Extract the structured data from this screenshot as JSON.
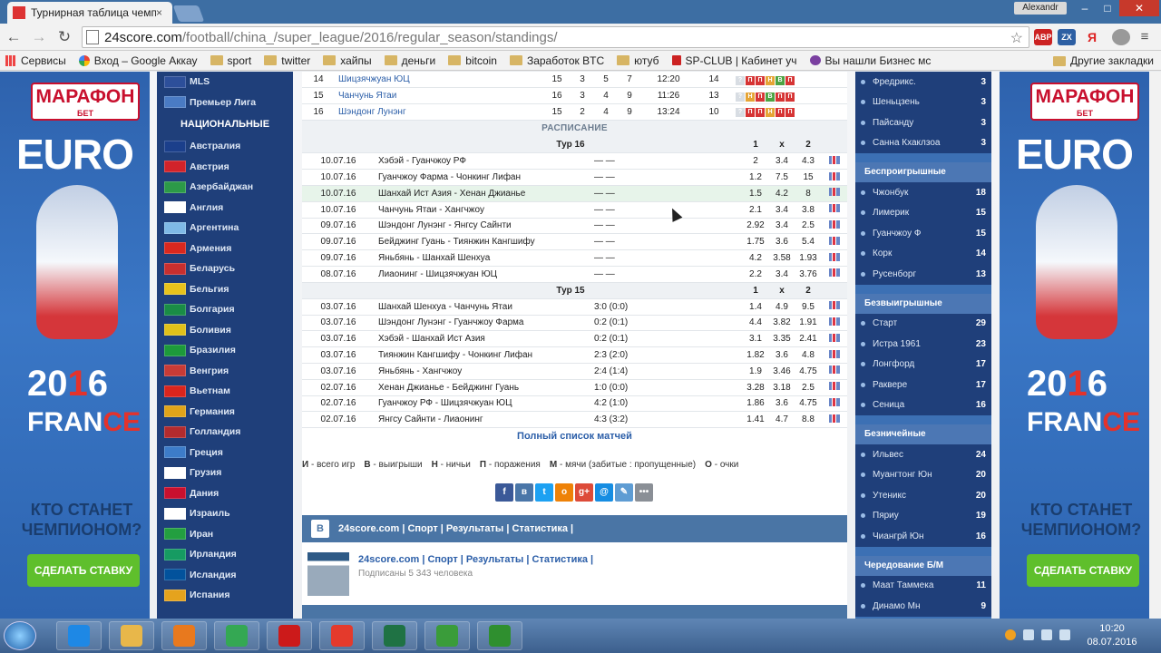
{
  "browser": {
    "tab_title": "Турнирная таблица чемп",
    "tab_close": "×",
    "window_user": "Alexandr",
    "window_controls": {
      "minimize": "–",
      "maximize": "□",
      "close": "✕"
    },
    "url_host": "24score.com",
    "url_path": "/football/china_/super_league/2016/regular_season/standings/",
    "nav": {
      "back": "←",
      "forward": "→",
      "reload": "↻"
    },
    "star": "☆",
    "extensions": [
      "ABP",
      "ZX",
      "Я",
      "≡"
    ]
  },
  "bookmarks": [
    {
      "label": "Сервисы",
      "icon": "apps-icon"
    },
    {
      "label": "Вход – Google Аккау",
      "icon": "google-icon"
    },
    {
      "label": "sport",
      "icon": "folder-icon"
    },
    {
      "label": "twitter",
      "icon": "folder-icon"
    },
    {
      "label": "хайпы",
      "icon": "folder-icon"
    },
    {
      "label": "деньги",
      "icon": "folder-icon"
    },
    {
      "label": "bitcoin",
      "icon": "folder-icon"
    },
    {
      "label": "Заработок BTC",
      "icon": "folder-icon"
    },
    {
      "label": "ютуб",
      "icon": "folder-icon"
    },
    {
      "label": "SP-CLUB | Кабинет уч",
      "icon": "k-icon"
    },
    {
      "label": "Вы нашли Бизнес мс",
      "icon": "site-icon"
    }
  ],
  "bookmarks_other": "Другие закладки",
  "ad": {
    "brand": "МАРАФОН",
    "brand_sub": "БЕТ",
    "euro": "EURO",
    "year_a": "20",
    "year_b": "1",
    "year_c": "6",
    "france_a": "FRAN",
    "france_b": "CE",
    "question": "КТО СТАНЕТ ЧЕМПИОНОМ?",
    "bet_button": "СДЕЛАТЬ СТАВКУ"
  },
  "left_nav": {
    "top_items": [
      "MLS",
      "Премьер Лига"
    ],
    "header": "НАЦИОНАЛЬНЫЕ",
    "countries": [
      {
        "name": "Австралия",
        "color": "#1b3f8b"
      },
      {
        "name": "Австрия",
        "color": "#d2232a"
      },
      {
        "name": "Азербайджан",
        "color": "#2c9a48"
      },
      {
        "name": "Англия",
        "color": "#ffffff"
      },
      {
        "name": "Аргентина",
        "color": "#7fb9e6"
      },
      {
        "name": "Армения",
        "color": "#d9281f"
      },
      {
        "name": "Беларусь",
        "color": "#c82f2f"
      },
      {
        "name": "Бельгия",
        "color": "#e8c31c"
      },
      {
        "name": "Болгария",
        "color": "#1a8c46"
      },
      {
        "name": "Боливия",
        "color": "#e1c11a"
      },
      {
        "name": "Бразилия",
        "color": "#1d9a3b"
      },
      {
        "name": "Венгрия",
        "color": "#c83b36"
      },
      {
        "name": "Вьетнам",
        "color": "#da251d"
      },
      {
        "name": "Германия",
        "color": "#e0a41a"
      },
      {
        "name": "Голландия",
        "color": "#b32b2e"
      },
      {
        "name": "Греция",
        "color": "#3d7cc9"
      },
      {
        "name": "Грузия",
        "color": "#ffffff"
      },
      {
        "name": "Дания",
        "color": "#c8102e"
      },
      {
        "name": "Израиль",
        "color": "#ffffff"
      },
      {
        "name": "Иран",
        "color": "#239f40"
      },
      {
        "name": "Ирландия",
        "color": "#169b62"
      },
      {
        "name": "Исландия",
        "color": "#02529c"
      },
      {
        "name": "Испания",
        "color": "#e5a31d"
      }
    ]
  },
  "standings": [
    {
      "pos": "14",
      "team": "Шицзячжуан ЮЦ",
      "g": "15",
      "w": "3",
      "d": "5",
      "l": "7",
      "goals": "12:20",
      "pts": "14",
      "form": [
        "N",
        "L",
        "L",
        "D",
        "W",
        "L"
      ]
    },
    {
      "pos": "15",
      "team": "Чанчунь Ятаи",
      "g": "16",
      "w": "3",
      "d": "4",
      "l": "9",
      "goals": "11:26",
      "pts": "13",
      "form": [
        "N",
        "D",
        "L",
        "W",
        "L",
        "L"
      ]
    },
    {
      "pos": "16",
      "team": "Шэндонг Лунэнг",
      "g": "15",
      "w": "2",
      "d": "4",
      "l": "9",
      "goals": "13:24",
      "pts": "10",
      "form": [
        "N",
        "L",
        "L",
        "D",
        "L",
        "L"
      ]
    }
  ],
  "schedule": {
    "title": "РАСПИСАНИЕ",
    "odds_headers": [
      "1",
      "x",
      "2"
    ],
    "rounds": [
      {
        "name": "Тур 16",
        "matches": [
          {
            "date": "10.07.16",
            "match": "Хэбэй - Гуанчжоу РФ",
            "score": "— —",
            "o1": "2",
            "ox": "3.4",
            "o2": "4.3"
          },
          {
            "date": "10.07.16",
            "match": "Гуанчжоу Фарма - Чонкинг Лифан",
            "score": "— —",
            "o1": "1.2",
            "ox": "7.5",
            "o2": "15"
          },
          {
            "date": "10.07.16",
            "match": "Шанхай Ист Азия - Хенан Джианье",
            "score": "— —",
            "o1": "1.5",
            "ox": "4.2",
            "o2": "8",
            "highlight": true
          },
          {
            "date": "10.07.16",
            "match": "Чанчунь Ятаи - Хангчжоу",
            "score": "— —",
            "o1": "2.1",
            "ox": "3.4",
            "o2": "3.8"
          },
          {
            "date": "09.07.16",
            "match": "Шэндонг Лунэнг - Янгсу Сайнти",
            "score": "— —",
            "o1": "2.92",
            "ox": "3.4",
            "o2": "2.5"
          },
          {
            "date": "09.07.16",
            "match": "Бейджинг Гуань - Тиянжин Кангшифу",
            "score": "— —",
            "o1": "1.75",
            "ox": "3.6",
            "o2": "5.4"
          },
          {
            "date": "09.07.16",
            "match": "Яньбянь - Шанхай Шенхуа",
            "score": "— —",
            "o1": "4.2",
            "ox": "3.58",
            "o2": "1.93"
          },
          {
            "date": "08.07.16",
            "match": "Лиаонинг - Шицзячжуан ЮЦ",
            "score": "— —",
            "o1": "2.2",
            "ox": "3.4",
            "o2": "3.76"
          }
        ]
      },
      {
        "name": "Тур 15",
        "matches": [
          {
            "date": "03.07.16",
            "match": "Шанхай Шенхуа - Чанчунь Ятаи",
            "score": "3:0 (0:0)",
            "o1": "1.4",
            "ox": "4.9",
            "o2": "9.5"
          },
          {
            "date": "03.07.16",
            "match": "Шэндонг Лунэнг - Гуанчжоу Фарма",
            "score": "0:2 (0:1)",
            "o1": "4.4",
            "ox": "3.82",
            "o2": "1.91"
          },
          {
            "date": "03.07.16",
            "match": "Хэбэй - Шанхай Ист Азия",
            "score": "0:2 (0:1)",
            "o1": "3.1",
            "ox": "3.35",
            "o2": "2.41"
          },
          {
            "date": "03.07.16",
            "match": "Тиянжин Кангшифу - Чонкинг Лифан",
            "score": "2:3 (2:0)",
            "o1": "1.82",
            "ox": "3.6",
            "o2": "4.8"
          },
          {
            "date": "03.07.16",
            "match": "Яньбянь - Хангчжоу",
            "score": "2:4 (1:4)",
            "o1": "1.9",
            "ox": "3.46",
            "o2": "4.75"
          },
          {
            "date": "02.07.16",
            "match": "Хенан Джианье - Бейджинг Гуань",
            "score": "1:0 (0:0)",
            "o1": "3.28",
            "ox": "3.18",
            "o2": "2.5"
          },
          {
            "date": "02.07.16",
            "match": "Гуанчжоу РФ - Шицзячжуан ЮЦ",
            "score": "4:2 (1:0)",
            "o1": "1.86",
            "ox": "3.6",
            "o2": "4.75"
          },
          {
            "date": "02.07.16",
            "match": "Янгсу Сайнти - Лиаонинг",
            "score": "4:3 (3:2)",
            "o1": "1.41",
            "ox": "4.7",
            "o2": "8.8"
          }
        ]
      }
    ],
    "full_list": "Полный список матчей"
  },
  "legend": [
    {
      "k": "И",
      "v": "всего игр"
    },
    {
      "k": "В",
      "v": "выигрыши"
    },
    {
      "k": "Н",
      "v": "ничьи"
    },
    {
      "k": "П",
      "v": "поражения"
    },
    {
      "k": "М",
      "v": "мячи (забитые : пропущенные)"
    },
    {
      "k": "О",
      "v": "очки"
    }
  ],
  "social": [
    {
      "name": "facebook-icon",
      "glyph": "f",
      "color": "#3b5998"
    },
    {
      "name": "vk-icon",
      "glyph": "в",
      "color": "#4a76a8"
    },
    {
      "name": "twitter-icon",
      "glyph": "t",
      "color": "#1da1f2"
    },
    {
      "name": "odnoklassniki-icon",
      "glyph": "о",
      "color": "#ee8208"
    },
    {
      "name": "googleplus-icon",
      "glyph": "g+",
      "color": "#dd4b39"
    },
    {
      "name": "mailru-icon",
      "glyph": "@",
      "color": "#168de2"
    },
    {
      "name": "livejournal-icon",
      "glyph": "✎",
      "color": "#5e9cd3"
    },
    {
      "name": "more-icon",
      "glyph": "•••",
      "color": "#8a8f96"
    }
  ],
  "vk_widget": {
    "badge": "B",
    "header": "24score.com | Спорт | Результаты | Статистика |",
    "title": "24score.com | Спорт | Результаты | Статистика |",
    "subs": "Подписаны 5 343 человека"
  },
  "right_bar": [
    {
      "title": "",
      "items": [
        {
          "name": "Фредрикс.",
          "v": "3"
        },
        {
          "name": "Шеньцзень",
          "v": "3"
        },
        {
          "name": "Пайсанду",
          "v": "3"
        },
        {
          "name": "Санна Кхаклзоа",
          "v": "3"
        }
      ]
    },
    {
      "title": "Беспроигрышные",
      "items": [
        {
          "name": "Чжонбук",
          "v": "18"
        },
        {
          "name": "Лимерик",
          "v": "15"
        },
        {
          "name": "Гуанчжоу Ф",
          "v": "15"
        },
        {
          "name": "Корк",
          "v": "14"
        },
        {
          "name": "Русенборг",
          "v": "13"
        }
      ]
    },
    {
      "title": "Безвыигрышные",
      "items": [
        {
          "name": "Старт",
          "v": "29"
        },
        {
          "name": "Истра 1961",
          "v": "23"
        },
        {
          "name": "Лонгфорд",
          "v": "17"
        },
        {
          "name": "Ракверe",
          "v": "17"
        },
        {
          "name": "Сеница",
          "v": "16"
        }
      ]
    },
    {
      "title": "Безничейные",
      "items": [
        {
          "name": "Ильвес",
          "v": "24"
        },
        {
          "name": "Муангтонг Юн",
          "v": "20"
        },
        {
          "name": "Утеникс",
          "v": "20"
        },
        {
          "name": "Пяриу",
          "v": "19"
        },
        {
          "name": "Чиангрй Юн",
          "v": "16"
        }
      ]
    },
    {
      "title": "Чередование Б/М",
      "items": [
        {
          "name": "Маат Таммека",
          "v": "11"
        },
        {
          "name": "Динамо Мн",
          "v": "9"
        }
      ]
    }
  ],
  "taskbar": {
    "apps": [
      {
        "name": "ie-icon",
        "color": "#1e88e5"
      },
      {
        "name": "explorer-icon",
        "color": "#e8b74a"
      },
      {
        "name": "media-player-icon",
        "color": "#e8791e"
      },
      {
        "name": "chrome-icon",
        "color": "#34a853"
      },
      {
        "name": "opera-icon",
        "color": "#cc1a1a"
      },
      {
        "name": "yandex-icon",
        "color": "#e43a2c"
      },
      {
        "name": "excel-icon",
        "color": "#1f7244"
      },
      {
        "name": "camtasia-icon",
        "color": "#3a9c3a"
      },
      {
        "name": "camtasia-recorder-icon",
        "color": "#2f8f2f"
      }
    ],
    "time": "10:20",
    "date": "08.07.2016"
  }
}
